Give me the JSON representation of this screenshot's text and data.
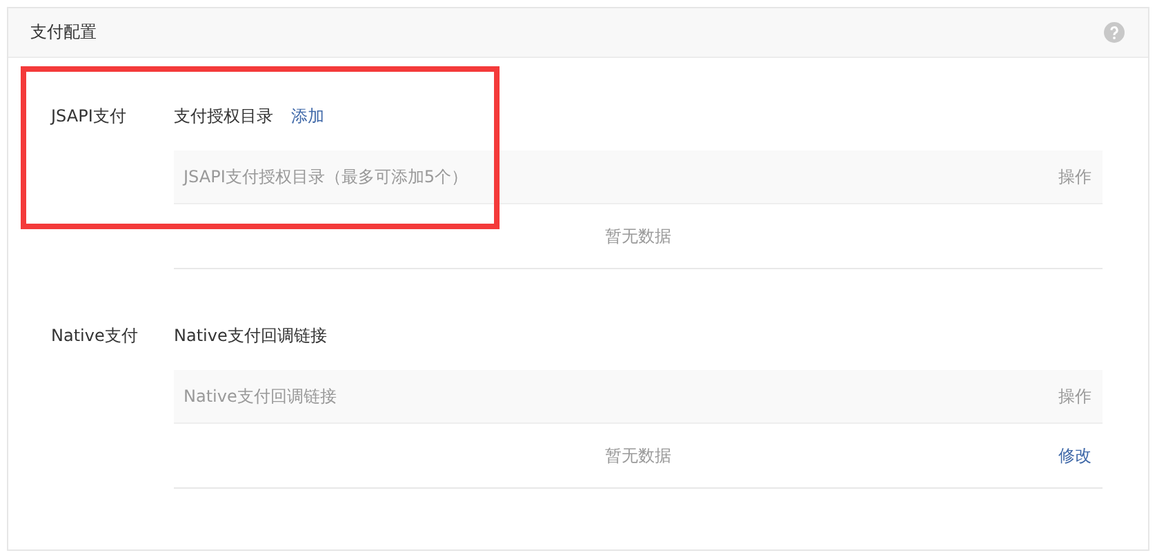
{
  "panel": {
    "title": "支付配置"
  },
  "sections": [
    {
      "label": "JSAPI支付",
      "heading": "支付授权目录",
      "heading_link": "添加",
      "highlighted": true,
      "table": {
        "columns": [
          "JSAPI支付授权目录（最多可添加5个）",
          "操作"
        ],
        "empty_text": "暂无数据"
      }
    },
    {
      "label": "Native支付",
      "heading": "Native支付回调链接",
      "highlighted": false,
      "table": {
        "columns": [
          "Native支付回调链接",
          "操作"
        ],
        "empty_text": "暂无数据",
        "row_action": "修改"
      }
    }
  ]
}
